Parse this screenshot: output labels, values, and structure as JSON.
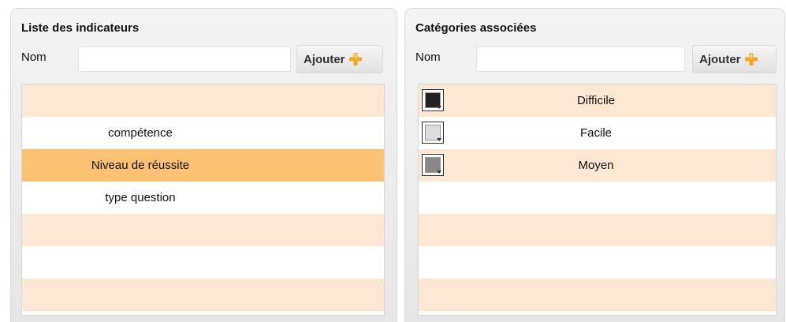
{
  "indicators_panel": {
    "title": "Liste des indicateurs",
    "name_label": "Nom",
    "name_value": "",
    "add_label": "Ajouter",
    "rows": [
      {
        "label": "",
        "selected": false
      },
      {
        "label": "compétence",
        "selected": false
      },
      {
        "label": "Niveau de réussite",
        "selected": true
      },
      {
        "label": "type question",
        "selected": false
      },
      {
        "label": "",
        "selected": false
      },
      {
        "label": "",
        "selected": false
      },
      {
        "label": "",
        "selected": false
      }
    ]
  },
  "categories_panel": {
    "title": "Catégories associées",
    "name_label": "Nom",
    "name_value": "",
    "add_label": "Ajouter",
    "rows": [
      {
        "label": "Difficile",
        "color": "#222222"
      },
      {
        "label": "Facile",
        "color": "#dddddd"
      },
      {
        "label": "Moyen",
        "color": "#888888"
      },
      {
        "label": "",
        "color": null
      },
      {
        "label": "",
        "color": null
      },
      {
        "label": "",
        "color": null
      },
      {
        "label": "",
        "color": null
      }
    ]
  },
  "colors": {
    "row_odd": "#fde8d4",
    "row_even": "#ffffff",
    "row_selected": "#fcc271",
    "accent_plus": "#f5a623"
  }
}
